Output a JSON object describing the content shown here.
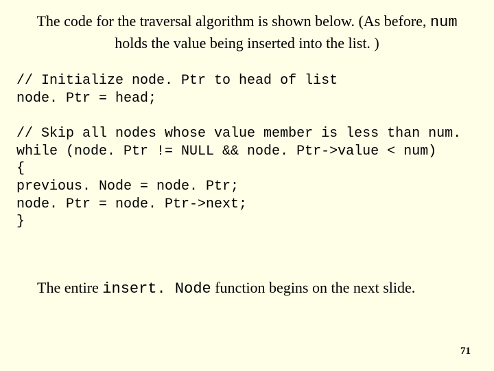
{
  "intro": {
    "part1": "The code for the traversal algorithm is shown below. (As before, ",
    "mono1": "num",
    "part2": " holds the value being inserted into the list. )"
  },
  "code": {
    "line1": "// Initialize node. Ptr to head of list",
    "line2": "node. Ptr = head;",
    "line3": "",
    "line4": "// Skip all nodes whose value member is less than num.",
    "line5": "while (node. Ptr != NULL && node. Ptr->value < num)",
    "line6": "{",
    "line7": "previous. Node = node. Ptr;",
    "line8": "node. Ptr = node. Ptr->next;",
    "line9": "}"
  },
  "closing": {
    "part1": "The entire ",
    "mono1": "insert. Node",
    "part2": " function begins on the next slide."
  },
  "page_number": "71"
}
